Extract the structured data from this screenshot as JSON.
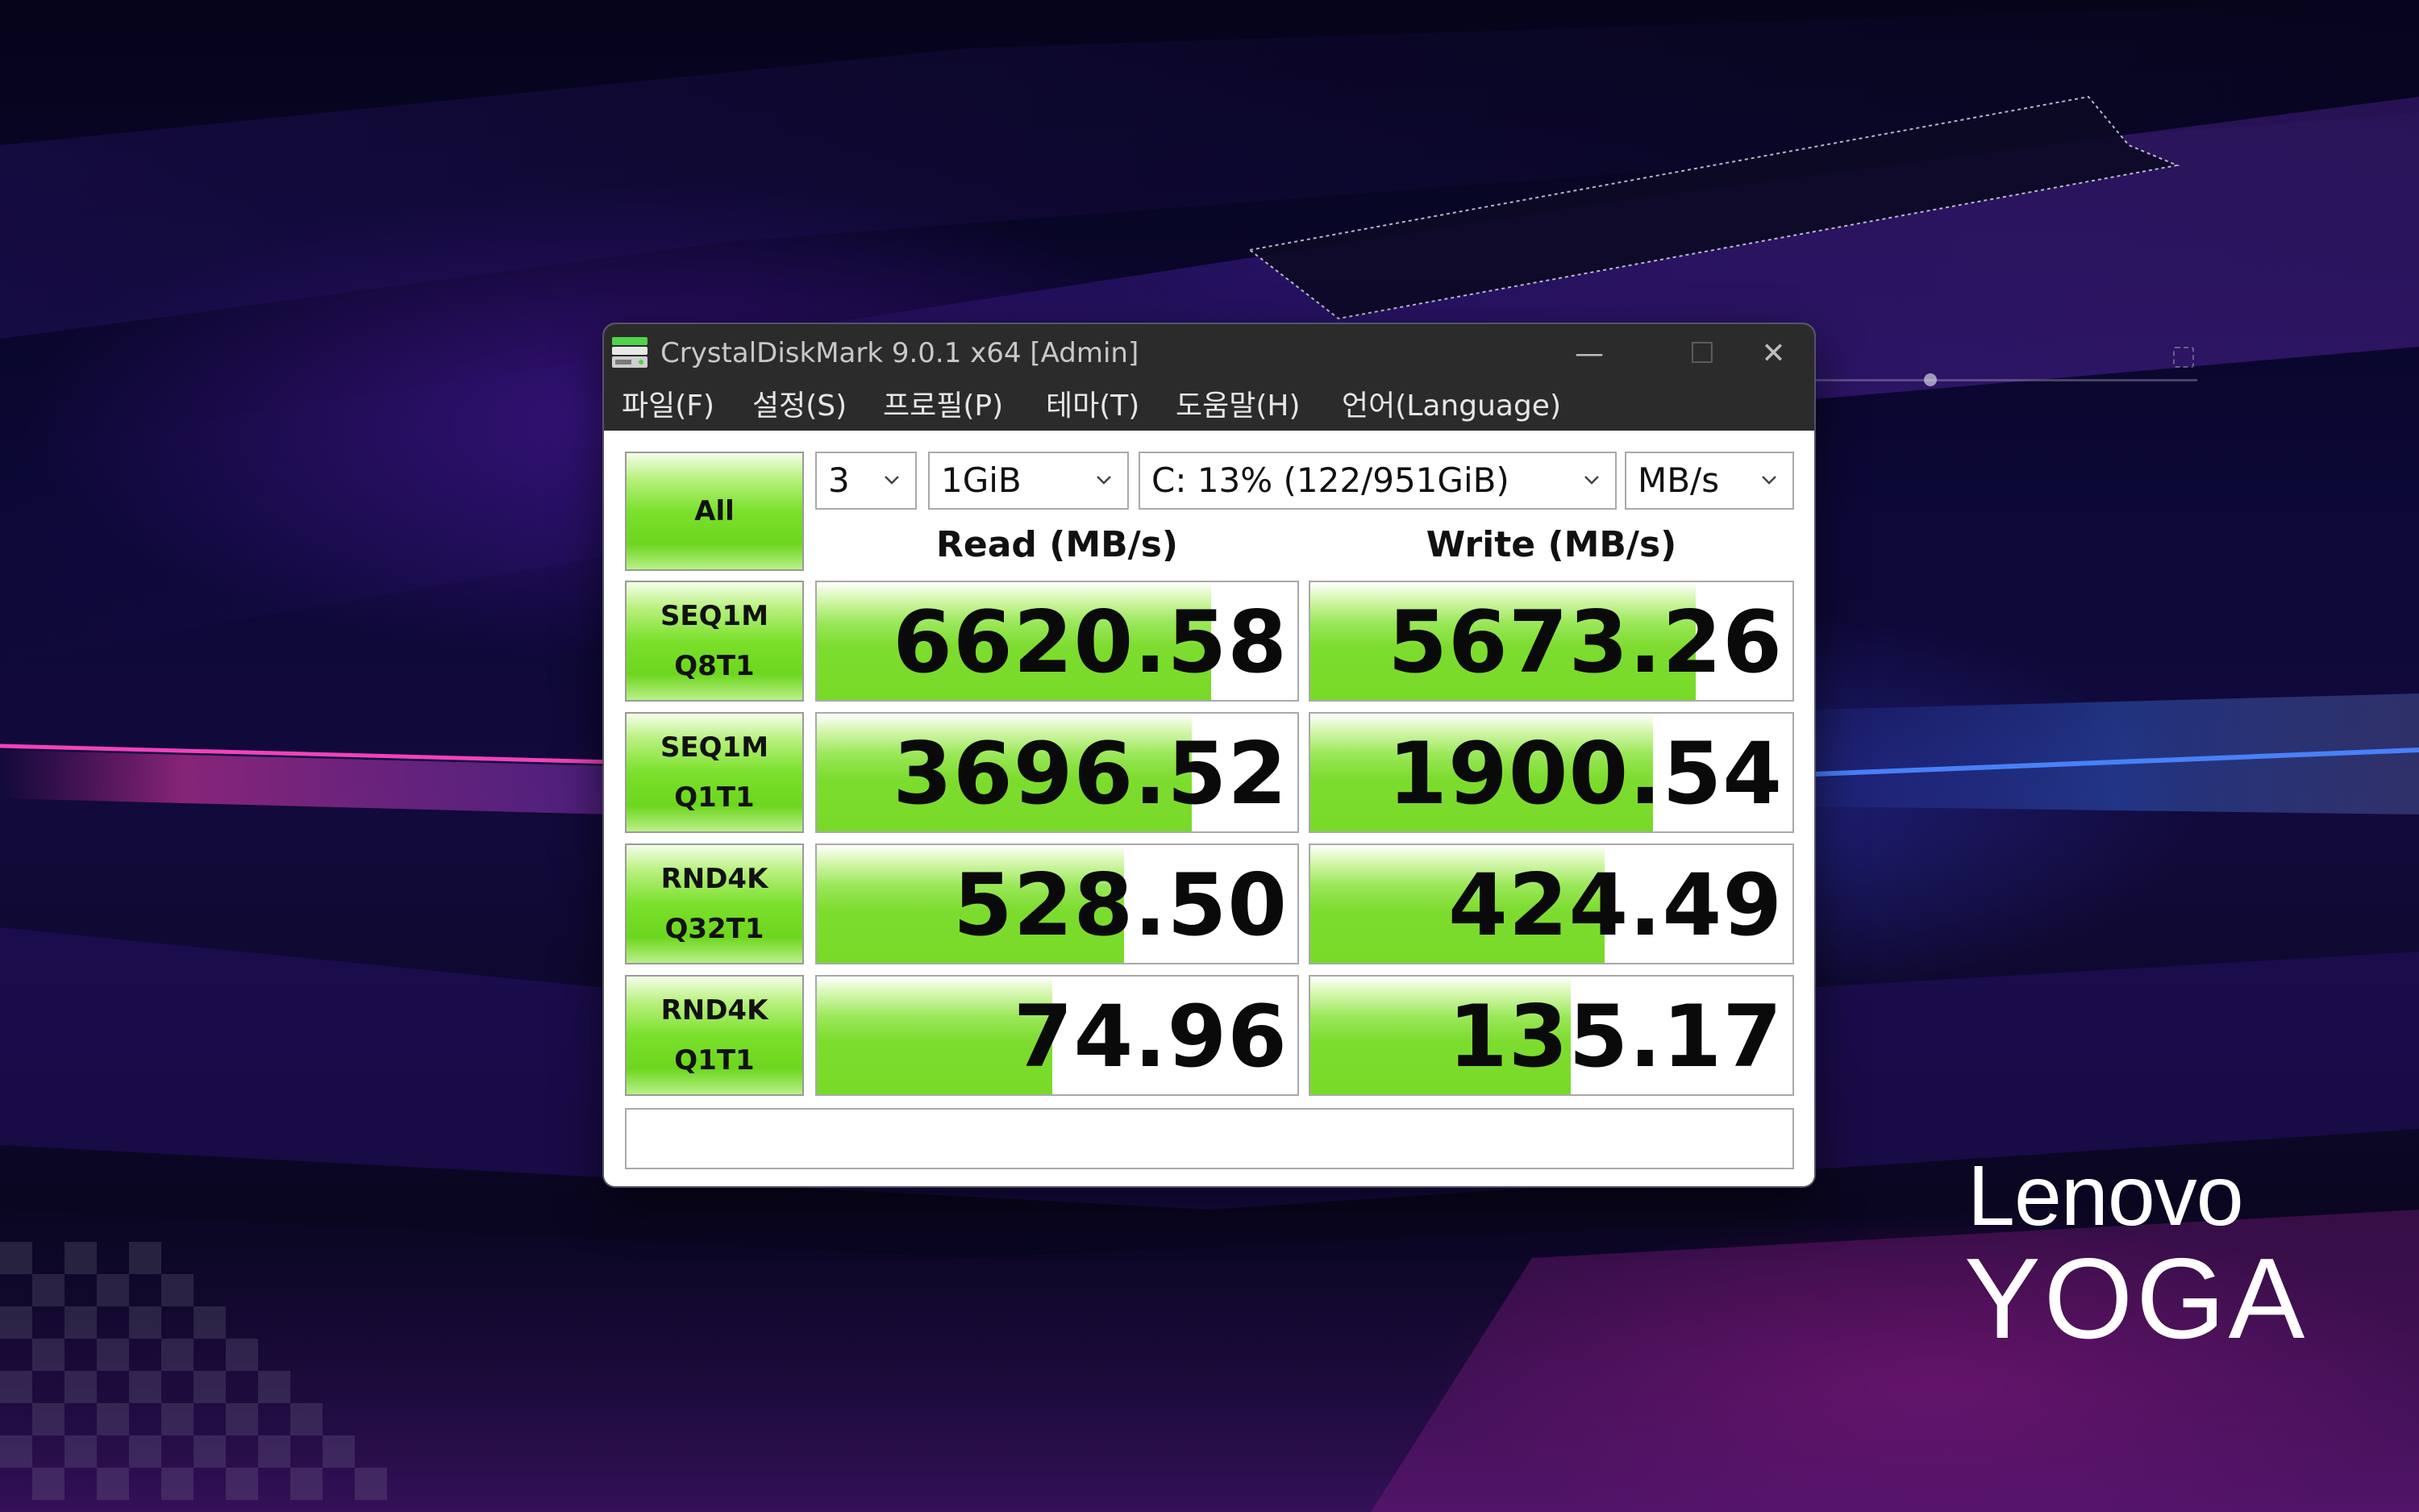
{
  "window": {
    "title": "CrystalDiskMark 9.0.1 x64 [Admin]",
    "controls": {
      "minimize": "—",
      "maximize": "☐",
      "close": "✕"
    }
  },
  "menu": [
    {
      "label": "파일(F)"
    },
    {
      "label": "설정(S)"
    },
    {
      "label": "프로필(P)"
    },
    {
      "label": "테마(T)"
    },
    {
      "label": "도움말(H)"
    },
    {
      "label": "언어(Language)"
    }
  ],
  "controls": {
    "all_label": "All",
    "runs": "3",
    "size": "1GiB",
    "drive": "C: 13% (122/951GiB)",
    "unit": "MB/s"
  },
  "headers": {
    "read": "Read (MB/s)",
    "write": "Write (MB/s)"
  },
  "tests": [
    {
      "line1": "SEQ1M",
      "line2": "Q8T1",
      "read": "6620.58",
      "write": "5673.26",
      "read_fill": 0.82,
      "write_fill": 0.8
    },
    {
      "line1": "SEQ1M",
      "line2": "Q1T1",
      "read": "3696.52",
      "write": "1900.54",
      "read_fill": 0.78,
      "write_fill": 0.71
    },
    {
      "line1": "RND4K",
      "line2": "Q32T1",
      "read": "528.50",
      "write": "424.49",
      "read_fill": 0.64,
      "write_fill": 0.61
    },
    {
      "line1": "RND4K",
      "line2": "Q1T1",
      "read": "74.96",
      "write": "135.17",
      "read_fill": 0.49,
      "write_fill": 0.54
    }
  ],
  "comment": "",
  "brand": {
    "line1": "Lenovo",
    "line2": "YOGA"
  },
  "colors": {
    "bar_green": "#7ddc2f",
    "titlebar": "#2b2b2b"
  }
}
